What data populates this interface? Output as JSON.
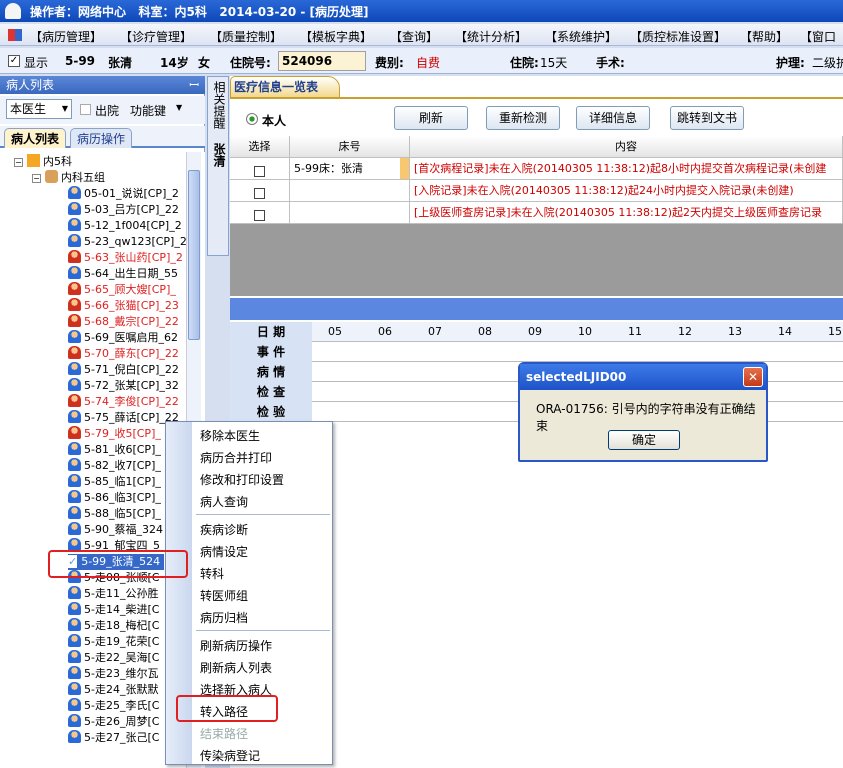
{
  "titlebar": {
    "text": "操作者：网络中心   科室：内5科   2014-03-20 - [病历处理]"
  },
  "menu": [
    "【病历管理】",
    "【诊疗管理】",
    "【质量控制】",
    "【模板字典】",
    "【查询】",
    "【统计分析】",
    "【系统维护】",
    "【质控标准设置】",
    "【帮助】",
    "【窗口"
  ],
  "info": {
    "show_label": "显示",
    "bed": "5-99",
    "name": "张清",
    "age": "14岁",
    "sex": "女",
    "inpatient_no_label": "住院号:",
    "inpatient_no": "524096",
    "fee_label": "费别:",
    "fee": "自费",
    "stay_label": "住院:",
    "stay": "15天",
    "surgery_label": "手术:",
    "nursing_label": "护理:",
    "nursing": "二级护"
  },
  "left": {
    "title": "病人列表",
    "pin": "ꟷ",
    "doctor_filter": "本医生",
    "discharged_label": "出院",
    "func_label": "功能键",
    "tab_patient": "病人列表",
    "tab_record": "病历操作"
  },
  "tree": {
    "dept": "内5科",
    "group": "内科五组",
    "patients": [
      {
        "label": "05-01_说说[CP]_2",
        "red": false
      },
      {
        "label": "5-03_吕方[CP]_22",
        "red": false
      },
      {
        "label": "5-12_1f004[CP]_2",
        "red": false
      },
      {
        "label": "5-23_qw123[CP]_2",
        "red": false
      },
      {
        "label": "5-63_张山药[CP]_2",
        "red": true
      },
      {
        "label": "5-64_出生日期_55",
        "red": false
      },
      {
        "label": "5-65_顾大嫂[CP]_",
        "red": true
      },
      {
        "label": "5-66_张猫[CP]_23",
        "red": true
      },
      {
        "label": "5-68_戴宗[CP]_22",
        "red": true
      },
      {
        "label": "5-69_医嘱启用_62",
        "red": false
      },
      {
        "label": "5-70_薛东[CP]_22",
        "red": true
      },
      {
        "label": "5-71_倪白[CP]_22",
        "red": false
      },
      {
        "label": "5-72_张某[CP]_32",
        "red": false
      },
      {
        "label": "5-74_李俊[CP]_22",
        "red": true
      },
      {
        "label": "5-75_薛话[CP]_22",
        "red": false
      },
      {
        "label": "5-79_收5[CP]_",
        "red": true
      },
      {
        "label": "5-81_收6[CP]_",
        "red": false
      },
      {
        "label": "5-82_收7[CP]_",
        "red": false
      },
      {
        "label": "5-85_临1[CP]_",
        "red": false
      },
      {
        "label": "5-86_临3[CP]_",
        "red": false
      },
      {
        "label": "5-88_临5[CP]_",
        "red": false
      },
      {
        "label": "5-90_蔡福_324",
        "red": false
      },
      {
        "label": "5-91_郁宝四_5",
        "red": false
      },
      {
        "label": "5-99_张清_524",
        "red": false
      },
      {
        "label": "5-走08_张顺[C",
        "red": false
      },
      {
        "label": "5-走11_公孙胜",
        "red": false
      },
      {
        "label": "5-走14_柴进[C",
        "red": false
      },
      {
        "label": "5-走18_梅杞[C",
        "red": false
      },
      {
        "label": "5-走19_花荣[C",
        "red": false
      },
      {
        "label": "5-走22_吴海[C",
        "red": false
      },
      {
        "label": "5-走23_维尔瓦",
        "red": false
      },
      {
        "label": "5-走24_张默默",
        "red": false
      },
      {
        "label": "5-走25_李氏[C",
        "red": false
      },
      {
        "label": "5-走26_周梦[C",
        "red": false
      },
      {
        "label": "5-走27_张己[C",
        "red": false
      }
    ]
  },
  "sidetab": {
    "label1": "相关提醒",
    "label2": "张清"
  },
  "main": {
    "tab": "医疗信息一览表",
    "radio_label": "本人",
    "btn_refresh": "刷新",
    "btn_recheck": "重新检测",
    "btn_detail": "详细信息",
    "btn_jump": "跳转到文书",
    "grid_headers": [
      "选择",
      "床号",
      "内容"
    ],
    "rows": [
      {
        "bed": "5-99床：张清",
        "content": "[首次病程记录]未在入院(20140305  11:38:12)起8小时内提交首次病程记录(未创建"
      },
      {
        "bed": "",
        "content": "[入院记录]未在入院(20140305  11:38:12)起24小时内提交入院记录(未创建)"
      },
      {
        "bed": "",
        "content": "[上级医师查房记录]未在入院(20140305  11:38:12)起2天内提交上级医师查房记录"
      }
    ],
    "timeline": {
      "date_label": "日  期",
      "days": [
        "05",
        "06",
        "07",
        "08",
        "09",
        "10",
        "11",
        "12",
        "13",
        "14",
        "15"
      ],
      "rows": [
        "事  件",
        "病  情",
        "检  查",
        "检  验"
      ]
    }
  },
  "context_menu": {
    "items": [
      "移除本医生",
      "病历合并打印",
      "修改和打印设置",
      "病人查询",
      "疾病诊断",
      "病情设定",
      "转科",
      "转医师组",
      "病历归档",
      "刷新病历操作",
      "刷新病人列表",
      "选择新入病人",
      "转入路径",
      "结束路径",
      "传染病登记"
    ]
  },
  "dialog": {
    "title": "selectedLJID00",
    "message": "ORA-01756: 引号内的字符串没有正确结束",
    "ok": "确定",
    "close": "✕"
  }
}
